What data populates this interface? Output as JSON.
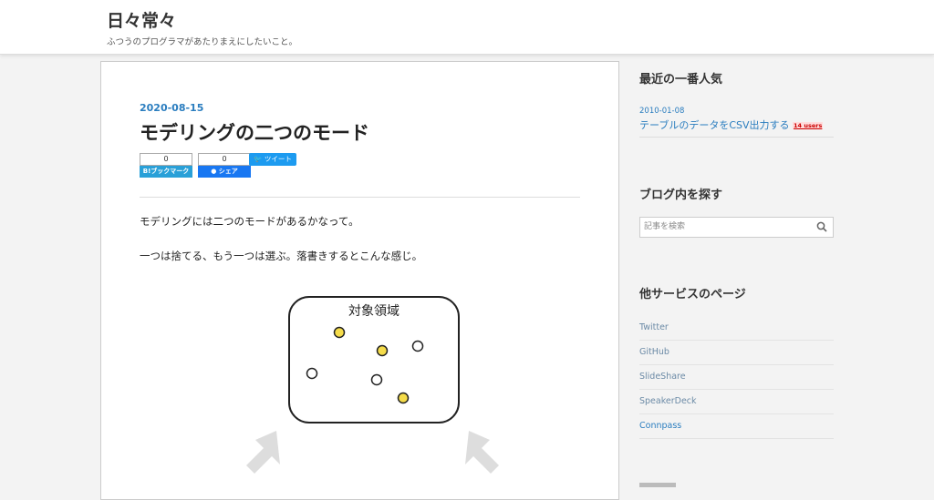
{
  "header": {
    "blog_title": "日々常々",
    "blog_description": "ふつうのプログラマがあたりまえにしたいこと。"
  },
  "article": {
    "date": "2020-08-15",
    "title": "モデリングの二つのモード",
    "share": {
      "hatena_count": "0",
      "hatena_label": "B!ブックマーク",
      "facebook_count": "0",
      "facebook_label": "シェア",
      "tweet_label": "ツイート"
    },
    "paragraphs": [
      "モデリングには二つのモードがあるかなって。",
      "一つは捨てる、もう一つは選ぶ。落書きするとこんな感じ。"
    ],
    "figure": {
      "label": "対象領域",
      "dots": [
        {
          "fill": "#f5dc4a"
        },
        {
          "fill": "#f5dc4a"
        },
        {
          "fill": "#ffffff"
        },
        {
          "fill": "#ffffff"
        },
        {
          "fill": "#ffffff"
        },
        {
          "fill": "#f5dc4a"
        }
      ]
    }
  },
  "sidebar": {
    "popular": {
      "heading": "最近の一番人気",
      "date": "2010-01-08",
      "link": "テーブルのデータをCSV出力する",
      "users": "14 users"
    },
    "search": {
      "heading": "ブログ内を探す",
      "placeholder": "記事を検索"
    },
    "services": {
      "heading": "他サービスのページ",
      "items": [
        "Twitter",
        "GitHub",
        "SlideShare",
        "SpeakerDeck",
        "Connpass"
      ]
    }
  },
  "colors": {
    "accent": "#2a7dbf",
    "hatena": "#29a0d8",
    "facebook": "#1877f2",
    "twitter": "#1d9bf0"
  }
}
